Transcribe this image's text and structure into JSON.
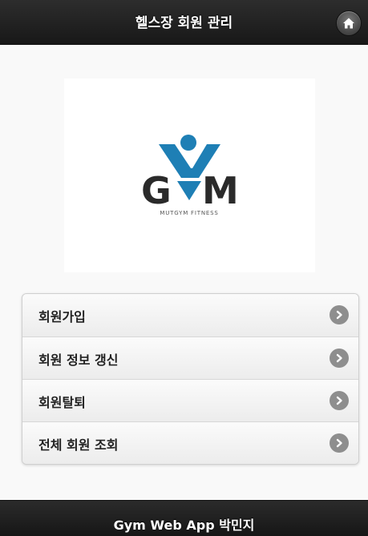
{
  "header": {
    "title": "헬스장 회원 관리",
    "home_icon": "home-icon"
  },
  "logo": {
    "letters_left": "G",
    "letters_right": "M",
    "tagline": "MUTGYM FITNESS",
    "brand_color": "#1e7fb5",
    "dark_color": "#2a2a2a"
  },
  "menu": {
    "items": [
      {
        "label": "회원가입",
        "icon": "chevron-right-icon"
      },
      {
        "label": "회원 정보 갱신",
        "icon": "chevron-right-icon"
      },
      {
        "label": "회원탈퇴",
        "icon": "chevron-right-icon"
      },
      {
        "label": "전체 회원 조회",
        "icon": "chevron-right-icon"
      }
    ]
  },
  "footer": {
    "text": "Gym Web App 박민지"
  }
}
